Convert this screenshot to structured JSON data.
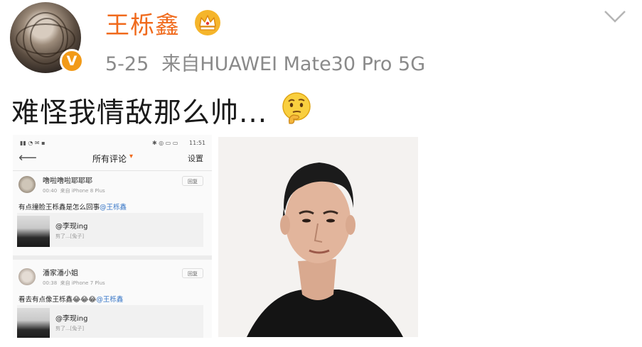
{
  "post": {
    "username": "王栎鑫",
    "date": "5-25",
    "source": "来自HUAWEI Mate30 Pro 5G",
    "text": "难怪我情敌那么帅...",
    "verified_badge": "V",
    "icons": [
      "crown-icon",
      "chevron-down-icon",
      "thinking-emoji-icon"
    ]
  },
  "screenshot": {
    "status_right": "11:51",
    "nav": {
      "title": "所有评论",
      "settings": "设置"
    },
    "comments": [
      {
        "name": "噜啦噜啦耶耶耶",
        "time": "00:40",
        "device": "来自 iPhone 8 Plus",
        "reply": "回复",
        "text": "有点撞脸王栎鑫是怎么回事",
        "mention": "@王栎鑫",
        "quote_handle": "@李现ing",
        "quote_sub": "剪了...[兔子]"
      },
      {
        "name": "潘家潘小姐",
        "time": "00:38",
        "device": "来自 iPhone 7 Plus",
        "reply": "回复",
        "text": "看去有点像王栎鑫😂😂😂",
        "mention": "@王栎鑫",
        "quote_handle": "@李现ing",
        "quote_sub": "剪了...[兔子]"
      }
    ]
  },
  "colors": {
    "username": "#f06a1c",
    "meta": "#8a8a8a",
    "badge": "#f29a18",
    "mention": "#3a78c8"
  }
}
